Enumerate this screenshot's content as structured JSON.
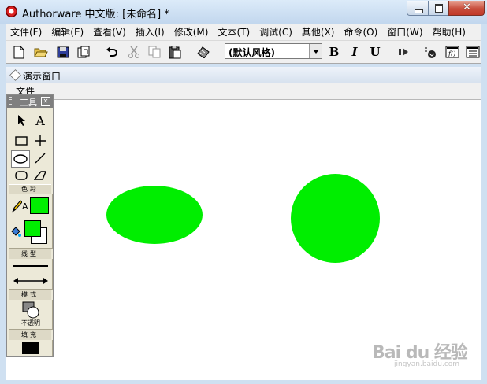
{
  "window": {
    "title": "Authorware 中文版: [未命名] *"
  },
  "menubar": {
    "items": [
      "文件(F)",
      "编辑(E)",
      "查看(V)",
      "插入(I)",
      "修改(M)",
      "文本(T)",
      "调试(C)",
      "其他(X)",
      "命令(O)",
      "窗口(W)",
      "帮助(H)"
    ]
  },
  "toolbar": {
    "style_value": "(默认风格)",
    "bold_label": "B",
    "italic_label": "I",
    "underline_label": "U"
  },
  "presentation": {
    "title": "演示窗口",
    "menu_file": "文件",
    "shape_color": "#00ee00"
  },
  "tools": {
    "title": "工具",
    "text_tool_label": "A",
    "color_section": "色彩",
    "line_section": "线型",
    "mode_section": "模式",
    "mode_value": "不透明",
    "fill_section": "填充",
    "fill_color": "#000000",
    "foreground_color": "#00ee00",
    "text_color_label": "A"
  },
  "watermark": {
    "brand": "Bai du 经验",
    "site": "jingyan.baidu.com"
  }
}
